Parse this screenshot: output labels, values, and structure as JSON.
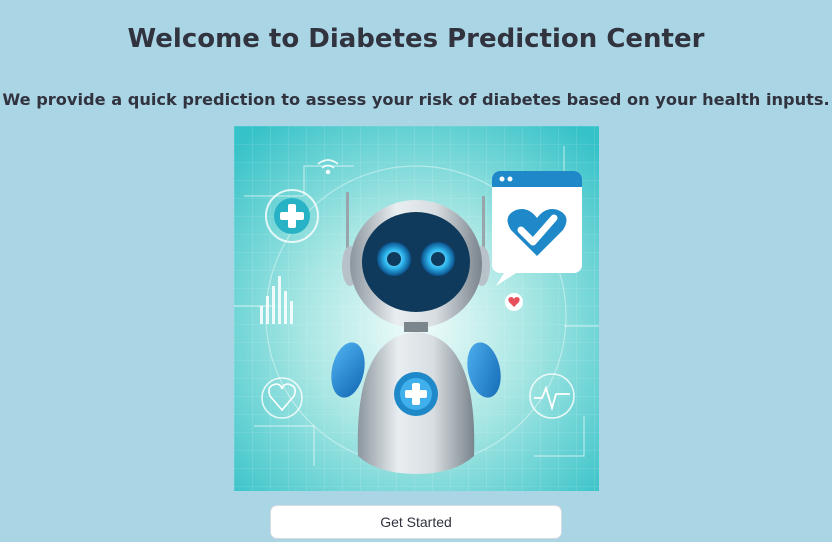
{
  "header": {
    "title": "Welcome to Diabetes Prediction Center",
    "subtitle": "We provide a quick prediction to assess your risk of diabetes based on your health inputs."
  },
  "hero": {
    "icons": [
      "robot-icon",
      "medical-cross-icon",
      "checkmark-heart-icon",
      "heart-icon",
      "wifi-icon",
      "bar-chart-icon",
      "heartbeat-icon"
    ]
  },
  "actions": {
    "get_started_label": "Get Started"
  },
  "colors": {
    "background": "#a9d5e4",
    "text": "#31333f",
    "button_bg": "#ffffff",
    "accent": "#1e88c9"
  }
}
